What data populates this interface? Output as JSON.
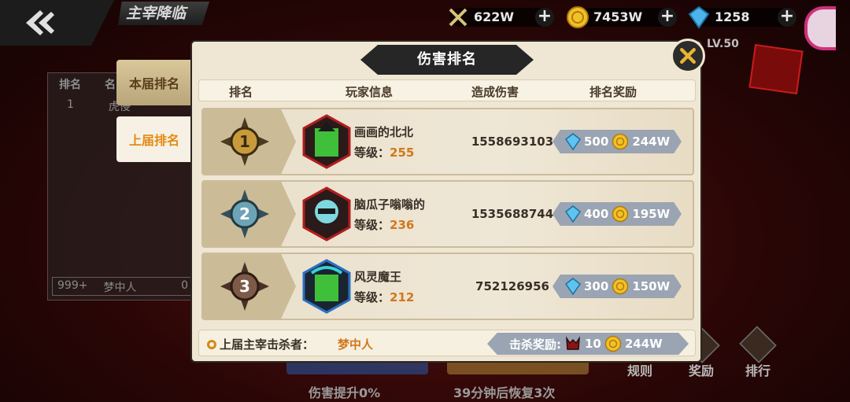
{
  "topbar": {
    "title": "主宰降临",
    "resources": [
      {
        "icon": "crossed-swords-icon",
        "value": "622W"
      },
      {
        "icon": "gold-coin-icon",
        "value": "7453W"
      },
      {
        "icon": "blue-gem-icon",
        "value": "1258"
      }
    ],
    "level": "LV.50"
  },
  "background": {
    "headers": [
      "排名",
      "名"
    ],
    "row": {
      "rank": "1",
      "name": "虎侵"
    },
    "self_rank": "999+",
    "self_name": "梦中人",
    "self_extra": "0",
    "buttons": [
      "伤害提升0%",
      "39分钟后恢复3次"
    ],
    "side_buttons": [
      "规则",
      "奖励",
      "排行"
    ]
  },
  "tabs": {
    "current": "本届排名",
    "previous": "上届排名"
  },
  "modal": {
    "title": "伤害排名",
    "columns": {
      "rank": "排名",
      "player": "玩家信息",
      "damage": "造成伤害",
      "reward": "排名奖励"
    },
    "level_prefix": "等级：",
    "rows": [
      {
        "rank": "1",
        "name": "画画的北北",
        "level": "255",
        "damage": "1558693103",
        "gems": "500",
        "gold": "244W"
      },
      {
        "rank": "2",
        "name": "脑瓜子嗡嗡的",
        "level": "236",
        "damage": "1535688744",
        "gems": "400",
        "gold": "195W"
      },
      {
        "rank": "3",
        "name": "风灵魔王",
        "level": "212",
        "damage": "752126956",
        "gems": "300",
        "gold": "150W"
      }
    ],
    "footer": {
      "label": "上届主宰击杀者：",
      "killer": "梦中人",
      "kill_reward_label": "击杀奖励:",
      "kill_reward_items": "10",
      "kill_reward_gold": "244W"
    }
  },
  "colors": {
    "accent_orange": "#d2771a",
    "panel_bg": "#efe7d3",
    "reward_plate": "#9aa4b2"
  }
}
